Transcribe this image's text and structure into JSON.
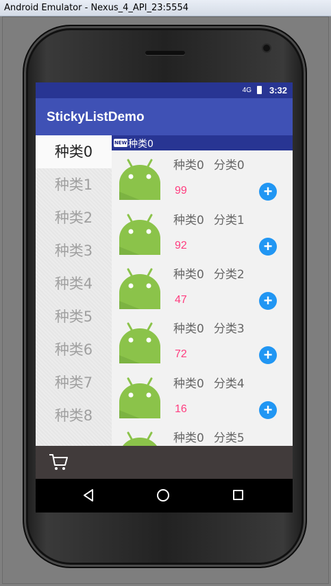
{
  "window": {
    "title": "Android Emulator - Nexus_4_API_23:5554"
  },
  "status_bar": {
    "network": "4G",
    "time": "3:32"
  },
  "toolbar": {
    "title": "StickyListDemo"
  },
  "menu": {
    "items": [
      "种类0",
      "种类1",
      "种类2",
      "种类3",
      "种类4",
      "种类5",
      "种类6",
      "种类7",
      "种类8"
    ],
    "active_index": 0
  },
  "sticky_header": {
    "badge": "NEW",
    "label": "种类0"
  },
  "list": {
    "items": [
      {
        "category": "种类0",
        "subcategory": "分类0",
        "sales": "99"
      },
      {
        "category": "种类0",
        "subcategory": "分类1",
        "sales": "92"
      },
      {
        "category": "种类0",
        "subcategory": "分类2",
        "sales": "47"
      },
      {
        "category": "种类0",
        "subcategory": "分类3",
        "sales": "72"
      },
      {
        "category": "种类0",
        "subcategory": "分类4",
        "sales": "16"
      },
      {
        "category": "种类0",
        "subcategory": "分类5",
        "sales": ""
      }
    ],
    "add_label": "+"
  },
  "icons": {
    "cart": "shopping-cart-icon",
    "back": "back-triangle-icon",
    "home": "home-circle-icon",
    "recent": "recent-apps-square-icon"
  },
  "colors": {
    "status_bar": "#283593",
    "toolbar": "#3f51b5",
    "price": "#ff3d7f",
    "add_button": "#2196f3",
    "bottom_bar": "#413b3b",
    "android": "#8bc34a"
  }
}
